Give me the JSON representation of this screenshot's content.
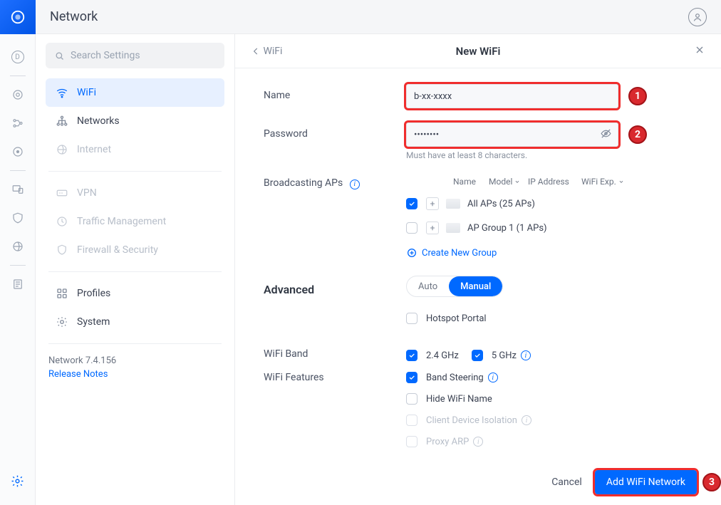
{
  "app_title": "Network",
  "search_placeholder": "Search Settings",
  "sidebar": {
    "items": [
      {
        "label": "WiFi"
      },
      {
        "label": "Networks"
      },
      {
        "label": "Internet"
      },
      {
        "label": "VPN"
      },
      {
        "label": "Traffic Management"
      },
      {
        "label": "Firewall & Security"
      },
      {
        "label": "Profiles"
      },
      {
        "label": "System"
      }
    ],
    "version": "Network 7.4.156",
    "release_notes": "Release Notes"
  },
  "panel": {
    "back_label": "WiFi",
    "title": "New WiFi",
    "name_label": "Name",
    "name_value": "b-xx-xxxx",
    "password_label": "Password",
    "password_value": "••••••••",
    "password_hint": "Must have at least 8 characters.",
    "broadcasting_label": "Broadcasting APs",
    "ap_columns": {
      "name": "Name",
      "model": "Model",
      "ip": "IP Address",
      "exp": "WiFi Exp."
    },
    "ap_rows": [
      {
        "label": "All APs (25 APs)",
        "checked": true
      },
      {
        "label": "AP Group 1 (1 APs)",
        "checked": false
      }
    ],
    "create_group": "Create New Group",
    "advanced_label": "Advanced",
    "mode": {
      "auto": "Auto",
      "manual": "Manual"
    },
    "hotspot_label": "Hotspot Portal",
    "band_label": "WiFi Band",
    "band_24": "2.4 GHz",
    "band_5": "5 GHz",
    "features_label": "WiFi Features",
    "band_steering": "Band Steering",
    "hide_name": "Hide WiFi Name",
    "client_isolation": "Client Device Isolation",
    "proxy_arp": "Proxy ARP",
    "cancel": "Cancel",
    "submit": "Add WiFi Network"
  },
  "annotations": {
    "a1": "1",
    "a2": "2",
    "a3": "3"
  }
}
